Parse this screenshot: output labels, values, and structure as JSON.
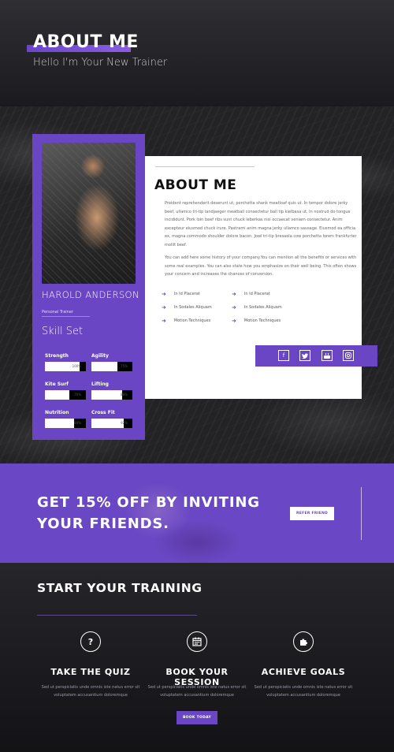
{
  "hero": {
    "title": "ABOUT ME",
    "subtitle": "Hello I'm Your New Trainer"
  },
  "profile": {
    "name": "HAROLD ANDERSON",
    "role": "Personal Trainer",
    "skills_title": "Skill Set",
    "skills": [
      {
        "label": "Strength",
        "percent": 100,
        "display": "100%"
      },
      {
        "label": "Agility",
        "percent": 75,
        "display": "75%"
      },
      {
        "label": "Kite Surf",
        "percent": 70,
        "display": "70%"
      },
      {
        "label": "Lifting",
        "percent": 88,
        "display": "88%"
      },
      {
        "label": "Nutrition",
        "percent": 84,
        "display": "84%"
      },
      {
        "label": "Cross Fit",
        "percent": 92,
        "display": "92%"
      }
    ]
  },
  "about": {
    "title": "ABOUT ME",
    "paragraph1": "Proident reprehenderit deserunt ut, porchetta shank meatloaf quis ut. In tempor dolore jerky beef, ullamco tri-tip landjaeger meatball consectetur ball tip kielbasa ut. In nostrud do tongue incididunt. Pork loin beef ribs sunt chuck leberkas nisi occaecat veniam consectetur. Anim excepteur eiusmod chuck irure. Pastrami anim magna jerky ullamco sausage. Eiusmod ea officia ex, magna commodo shoulder dolore bacon. Jowl tri-tip bresaola cow porchetta lorem frankfurter mollit beef.",
    "paragraph2": "You can add here some history of your company.You can mention all the benefits or services with some real examples. You can also state how you emphasize on their well being. This often shows your concern and increases the chances of conversion.",
    "features_left": [
      "In Id Placerat",
      "In Sodales Aliquam",
      "Motion Techniques"
    ],
    "features_right": [
      "In Id Placerat",
      "In Sodales Aliquam",
      "Motion Techniques"
    ],
    "social": [
      "f",
      "t",
      "yt",
      "ig"
    ]
  },
  "promo": {
    "line1": "GET 15% OFF BY INVITING",
    "line2": "YOUR FRIENDS.",
    "button": "REFER FRIEND"
  },
  "training": {
    "title": "START YOUR TRAINING",
    "columns": [
      {
        "icon": "question-icon",
        "heading": "TAKE THE QUIZ",
        "line1": "Sed ut perspiciatis unde omnis iste natus error sit",
        "line2": "voluptatem accusantium doloremque"
      },
      {
        "icon": "calendar-icon",
        "heading": "BOOK YOUR SESSION",
        "line1": "Sed ut perspiciatis unde omnis iste natus error sit",
        "line2": "voluptatem accusantium doloremque"
      },
      {
        "icon": "puzzle-icon",
        "heading": "ACHIEVE GOALS",
        "line1": "Sed ut perspiciatis unde omnis iste natus error sit",
        "line2": "voluptatem accusantium doloremque"
      }
    ],
    "button": "BOOK TODAY"
  },
  "colors": {
    "accent": "#6a45c4",
    "dark": "#141417"
  }
}
